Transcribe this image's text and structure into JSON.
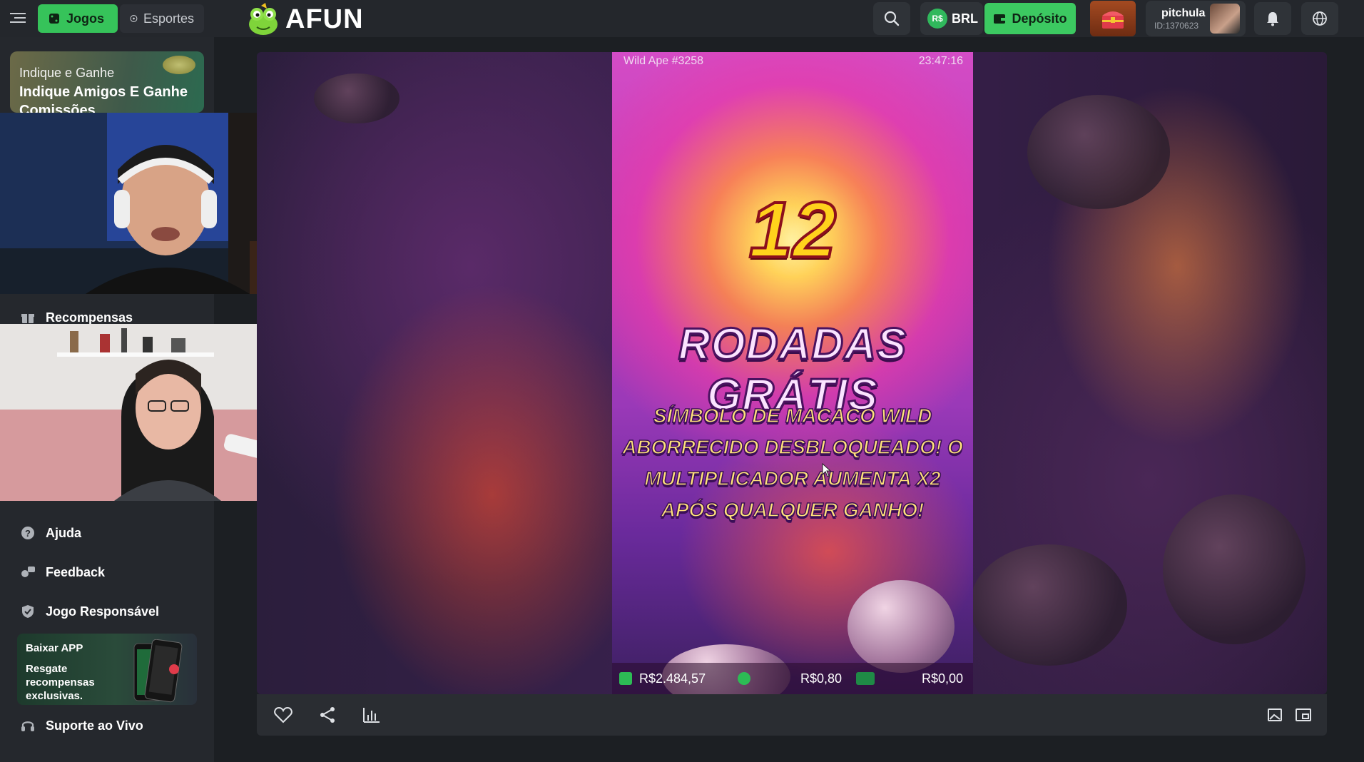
{
  "header": {
    "tabs": [
      {
        "label": "Jogos",
        "active": true
      },
      {
        "label": "Esportes",
        "active": false
      }
    ],
    "logo_text": "AFUN",
    "currency": "BRL",
    "currency_badge": "R$",
    "deposit_label": "Depósito",
    "user": {
      "name": "pitchula",
      "id": "ID:1370623"
    }
  },
  "sidebar": {
    "promo": {
      "subtitle": "Indique e Ganhe",
      "title": "Indique Amigos E Ganhe Comissões"
    },
    "items": [
      {
        "label": "Recompensas",
        "icon": "gift-icon"
      },
      {
        "label": "Ajuda",
        "icon": "help-icon"
      },
      {
        "label": "Feedback",
        "icon": "feedback-icon"
      },
      {
        "label": "Jogo Responsável",
        "icon": "shield-icon"
      },
      {
        "label": "Suporte ao Vivo",
        "icon": "headset-icon"
      }
    ],
    "app_card": {
      "title": "Baixar APP",
      "text": "Resgate recompensas exclusivas."
    }
  },
  "game": {
    "title": "Wild Ape #3258",
    "time": "23:47:16",
    "spins_count": "12",
    "spins_label": "RODADAS GRÁTIS",
    "description": "SÍMBOLO DE MACACO WILD ABORRECIDO DESBLOQUEADO! O MULTIPLICADOR AUMENTA X2 APÓS QUALQUER GANHO!",
    "balance": "R$2.484,57",
    "bet": "R$0,80",
    "win": "R$0,00"
  },
  "colors": {
    "accent_green": "#3cc961",
    "background": "#1c1f23",
    "panel": "#25282d"
  }
}
